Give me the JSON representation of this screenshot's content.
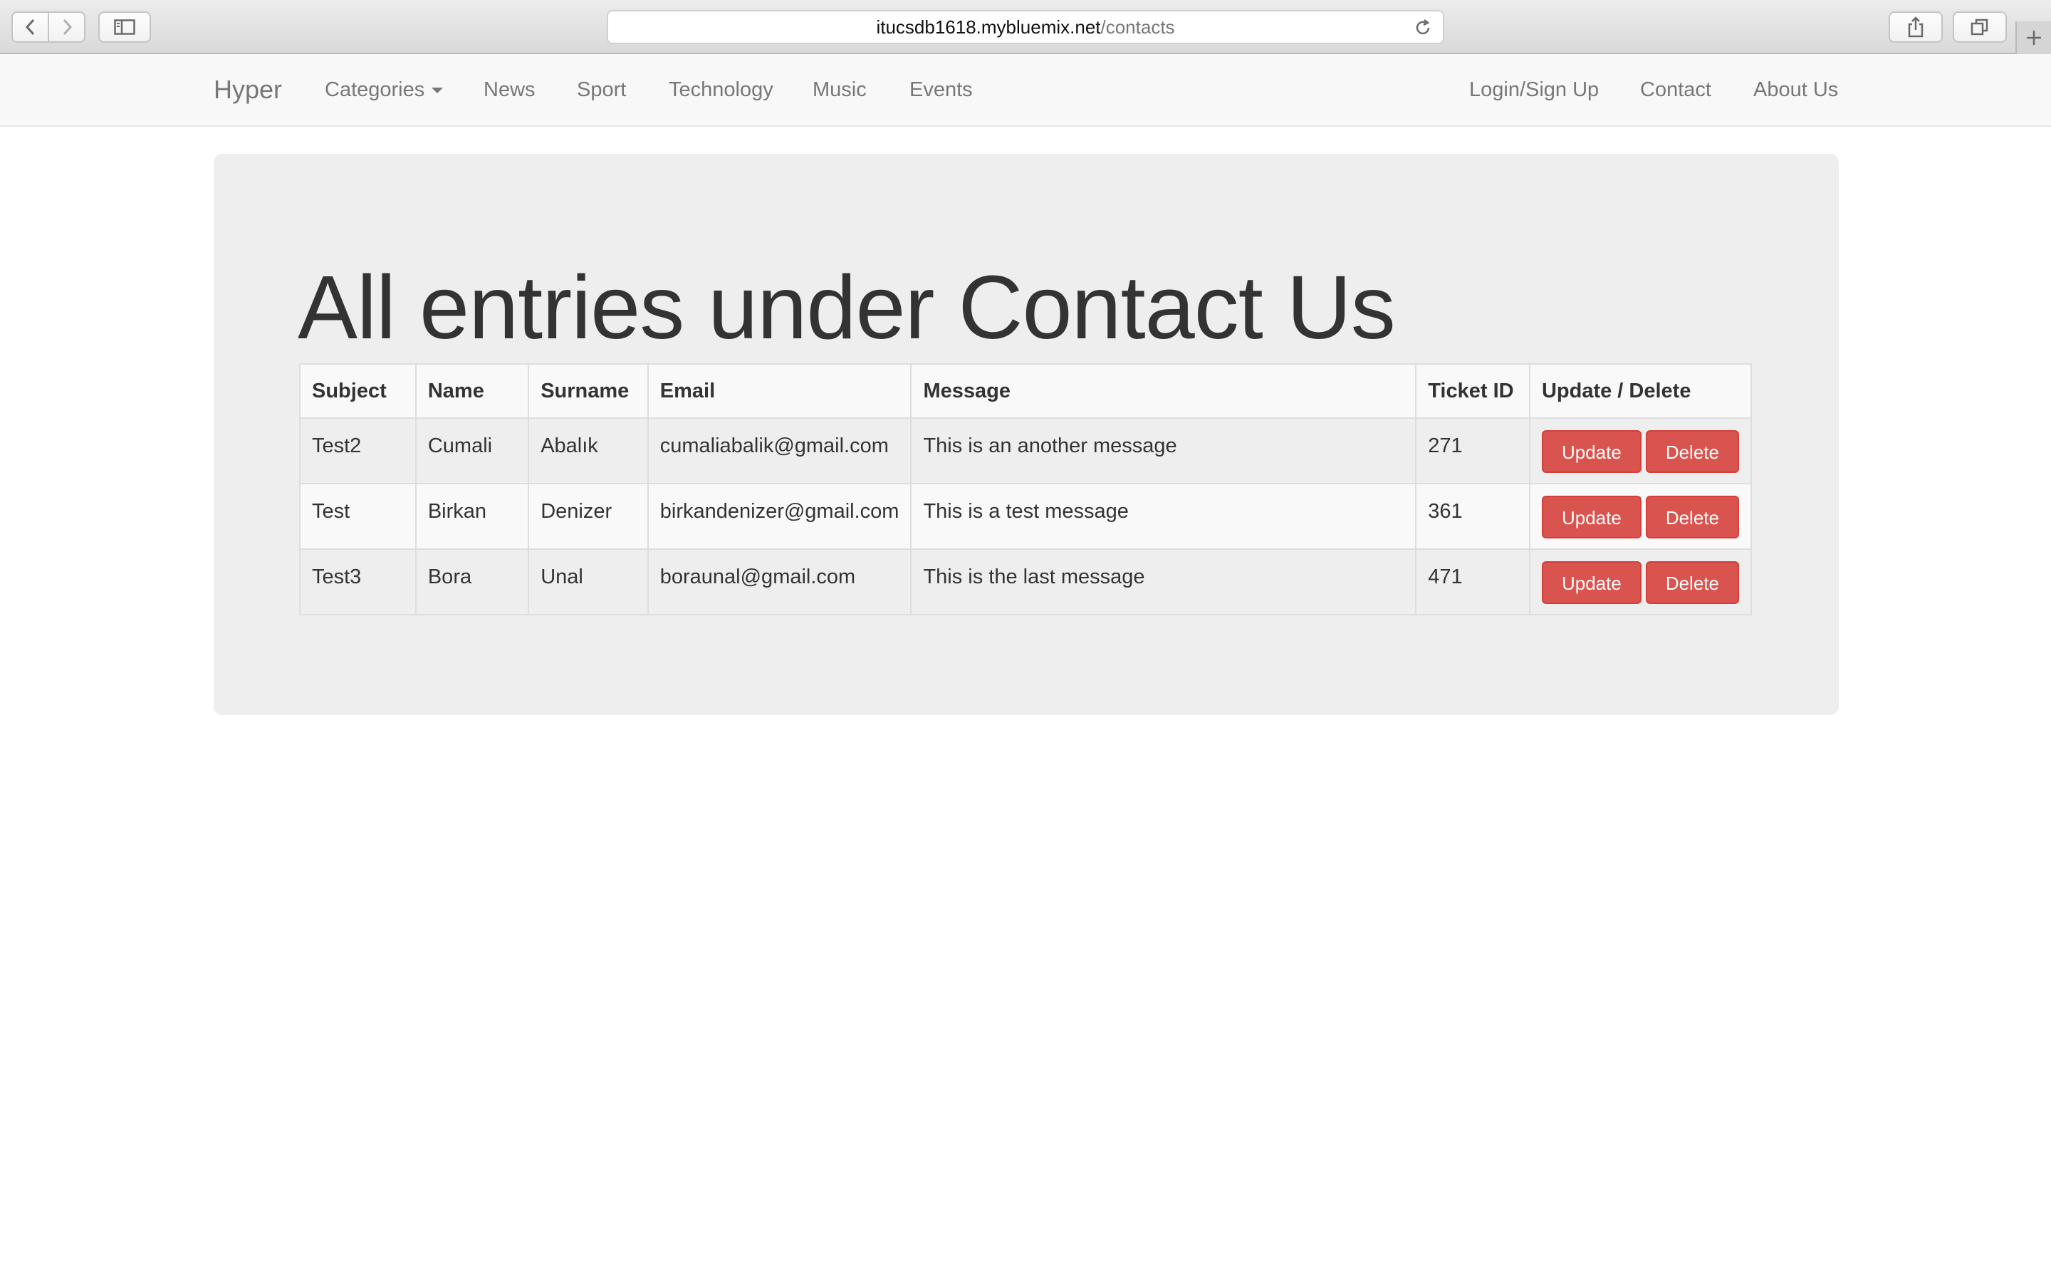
{
  "browser": {
    "url_host": "itucsdb1618.mybluemix.net",
    "url_path": "/contacts",
    "icons": [
      "back-icon",
      "forward-icon",
      "sidebar-icon",
      "reload-icon",
      "share-icon",
      "tabs-icon",
      "new-tab-icon"
    ]
  },
  "navbar": {
    "brand": "Hyper",
    "left_items": [
      "Categories",
      "News",
      "Sport",
      "Technology",
      "Music",
      "Events"
    ],
    "right_items": [
      "Login/Sign Up",
      "Contact",
      "About Us"
    ]
  },
  "main": {
    "heading": "All entries under Contact Us",
    "table": {
      "columns": [
        "Subject",
        "Name",
        "Surname",
        "Email",
        "Message",
        "Ticket ID",
        "Update / Delete"
      ],
      "rows": [
        {
          "subject": "Test2",
          "name": "Cumali",
          "surname": "Abalık",
          "email": "cumaliabalik@gmail.com",
          "message": "This is an another message",
          "ticket_id": "271"
        },
        {
          "subject": "Test",
          "name": "Birkan",
          "surname": "Denizer",
          "email": "birkandenizer@gmail.com",
          "message": "This is a test message",
          "ticket_id": "361"
        },
        {
          "subject": "Test3",
          "name": "Bora",
          "surname": "Unal",
          "email": "boraunal@gmail.com",
          "message": "This is the last message",
          "ticket_id": "471"
        }
      ],
      "update_label": "Update",
      "delete_label": "Delete"
    }
  },
  "colors": {
    "danger": "#d9534f",
    "jumbotron": "#eeeeee",
    "navbar": "#f8f8f8"
  }
}
